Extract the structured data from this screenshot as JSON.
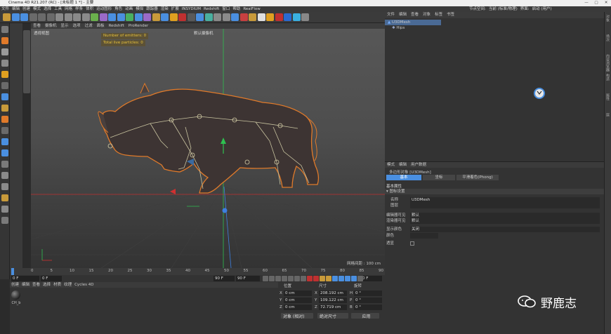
{
  "window": {
    "title": "Cinema 4D R21.207 (RC) - [未标题 1 *] - 主要",
    "controls": [
      "—",
      "▢",
      "✕"
    ]
  },
  "menubar": {
    "items": [
      "文件",
      "编辑",
      "创建",
      "模式",
      "选择",
      "工具",
      "网格",
      "样条",
      "体积",
      "运动图形",
      "角色",
      "动画",
      "模拟",
      "跟踪器",
      "渲染",
      "扩展",
      "INSYDIUM",
      "Redshift",
      "窗口",
      "帮助",
      "RealFlow"
    ],
    "right": [
      "节点空间:",
      "当前 (标准/物理)",
      "界面:",
      "启动 (用户)"
    ]
  },
  "viewport": {
    "menu": [
      "查看",
      "摄像机",
      "显示",
      "选项",
      "过滤",
      "面板",
      "Redshift",
      "ProRender"
    ],
    "label": "透视视图",
    "camera": "默认摄像机",
    "hud": {
      "emitters": "Number of emitters: 0",
      "particles": "Total live particles: 0"
    },
    "grid_info": "网格间距 : 100 cm"
  },
  "timeline": {
    "ticks": [
      "0",
      "5",
      "10",
      "15",
      "20",
      "25",
      "30",
      "35",
      "40",
      "45",
      "50",
      "55",
      "60",
      "65",
      "70",
      "75",
      "80",
      "85",
      "90"
    ],
    "current_frame": "0 F",
    "start": "0 F",
    "preview_start": "0 F",
    "preview_end": "90 F",
    "end": "90 F"
  },
  "material_panel": {
    "menu": [
      "创建",
      "编辑",
      "查看",
      "选择",
      "材质",
      "纹理",
      "Cycles 4D"
    ],
    "material_name": "CH_b"
  },
  "coordinates": {
    "headers": [
      "位置",
      "尺寸",
      "旋转"
    ],
    "rows": [
      {
        "axis": "X",
        "pos": "0 cm",
        "size_axis": "X",
        "size": "208.192 cm",
        "rot_axis": "H",
        "rot": "0 °"
      },
      {
        "axis": "Y",
        "pos": "0 cm",
        "size_axis": "Y",
        "size": "109.122 cm",
        "rot_axis": "P",
        "rot": "0 °"
      },
      {
        "axis": "Z",
        "pos": "0 cm",
        "size_axis": "Z",
        "size": "72.719 cm",
        "rot_axis": "B",
        "rot": "0 °"
      }
    ],
    "mode": "对象 (相对)",
    "size_mode": "绝对尺寸",
    "apply": "应用"
  },
  "object_manager": {
    "menu": [
      "文件",
      "编辑",
      "查看",
      "对象",
      "标签",
      "书签"
    ],
    "objects": [
      {
        "name": "U3DMesh",
        "indent": 0
      },
      {
        "name": "Hips",
        "indent": 1
      }
    ]
  },
  "attributes": {
    "menu": [
      "模式",
      "编辑",
      "用户数据"
    ],
    "object_title": "多边形对象 [U3DMesh]",
    "tabs": [
      "基本",
      "坐标",
      "平滑着色(Phong)"
    ],
    "section": "基本属性",
    "subsection": "▾ 图标设置",
    "fields": [
      {
        "label": "名称",
        "value": "U3DMesh"
      },
      {
        "label": "图层",
        "value": ""
      },
      {
        "label": "编辑器可见",
        "value": "默认"
      },
      {
        "label": "渲染器可见",
        "value": "默认"
      },
      {
        "label": "显示颜色",
        "value": "关闭"
      },
      {
        "label": "颜色",
        "value": ""
      },
      {
        "label": "透显",
        "value": ""
      }
    ]
  },
  "right_strip": [
    "对象",
    "场次",
    "内容浏览器",
    "构造",
    "属性",
    "层"
  ],
  "watermark": "野鹿志",
  "colors": {
    "accent_blue": "#4a8fe0",
    "hud_yellow": "#e8c23a",
    "outline_orange": "#e07a2a",
    "x_axis": "#d03030",
    "y_axis": "#2ec050",
    "z_axis": "#3d7fe0"
  }
}
